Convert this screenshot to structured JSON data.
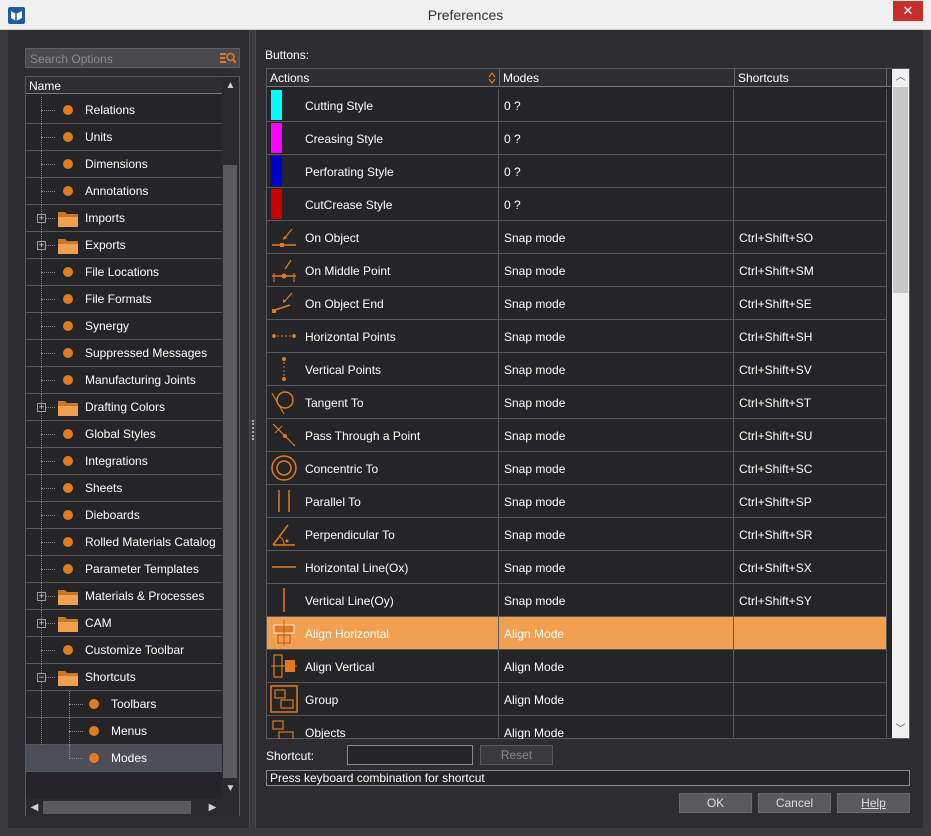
{
  "window": {
    "title": "Preferences",
    "close_glyph": "✕"
  },
  "search": {
    "placeholder": "Search Options"
  },
  "tree": {
    "header": "Name",
    "items": [
      {
        "label": "Relations",
        "kind": "leaf",
        "level": 1
      },
      {
        "label": "Units",
        "kind": "leaf",
        "level": 1
      },
      {
        "label": "Dimensions",
        "kind": "leaf",
        "level": 1
      },
      {
        "label": "Annotations",
        "kind": "leaf",
        "level": 1
      },
      {
        "label": "Imports",
        "kind": "folder",
        "level": 1,
        "expander": "+"
      },
      {
        "label": "Exports",
        "kind": "folder",
        "level": 1,
        "expander": "+"
      },
      {
        "label": "File Locations",
        "kind": "leaf",
        "level": 1
      },
      {
        "label": "File Formats",
        "kind": "leaf",
        "level": 1
      },
      {
        "label": "Synergy",
        "kind": "leaf",
        "level": 1
      },
      {
        "label": "Suppressed Messages",
        "kind": "leaf",
        "level": 1
      },
      {
        "label": "Manufacturing Joints",
        "kind": "leaf",
        "level": 1
      },
      {
        "label": "Drafting Colors",
        "kind": "folder",
        "level": 1,
        "expander": "+"
      },
      {
        "label": "Global Styles",
        "kind": "leaf",
        "level": 1
      },
      {
        "label": "Integrations",
        "kind": "leaf",
        "level": 1
      },
      {
        "label": "Sheets",
        "kind": "leaf",
        "level": 1
      },
      {
        "label": "Dieboards",
        "kind": "leaf",
        "level": 1
      },
      {
        "label": "Rolled Materials Catalog",
        "kind": "leaf",
        "level": 1
      },
      {
        "label": "Parameter Templates",
        "kind": "leaf",
        "level": 1
      },
      {
        "label": "Materials & Processes",
        "kind": "folder",
        "level": 1,
        "expander": "+"
      },
      {
        "label": "CAM",
        "kind": "folder",
        "level": 1,
        "expander": "+"
      },
      {
        "label": "Customize Toolbar",
        "kind": "leaf",
        "level": 1
      },
      {
        "label": "Shortcuts",
        "kind": "folder",
        "level": 1,
        "expander": "−"
      },
      {
        "label": "Toolbars",
        "kind": "leaf",
        "level": 2
      },
      {
        "label": "Menus",
        "kind": "leaf",
        "level": 2
      },
      {
        "label": "Modes",
        "kind": "leaf",
        "level": 2,
        "selected": true
      }
    ]
  },
  "buttons_label": "Buttons:",
  "grid": {
    "columns": [
      "Actions",
      "Modes",
      "Shortcuts"
    ],
    "rows": [
      {
        "action": "Cutting Style",
        "mode": "0 ?",
        "shortcut": "",
        "swatch": "#00ffff"
      },
      {
        "action": "Creasing Style",
        "mode": "0 ?",
        "shortcut": "",
        "swatch": "#ff00ff"
      },
      {
        "action": "Perforating Style",
        "mode": "0 ?",
        "shortcut": "",
        "swatch": "#0000cc"
      },
      {
        "action": "CutCrease Style",
        "mode": "0 ?",
        "shortcut": "",
        "swatch": "#cc0000"
      },
      {
        "action": "On Object",
        "mode": "Snap mode",
        "shortcut": "Ctrl+Shift+SO",
        "icon": "on-object-icon"
      },
      {
        "action": "On Middle Point",
        "mode": "Snap mode",
        "shortcut": "Ctrl+Shift+SM",
        "icon": "middle-point-icon"
      },
      {
        "action": "On Object End",
        "mode": "Snap mode",
        "shortcut": "Ctrl+Shift+SE",
        "icon": "object-end-icon"
      },
      {
        "action": "Horizontal Points",
        "mode": "Snap mode",
        "shortcut": "Ctrl+Shift+SH",
        "icon": "horizontal-points-icon"
      },
      {
        "action": "Vertical Points",
        "mode": "Snap mode",
        "shortcut": "Ctrl+Shift+SV",
        "icon": "vertical-points-icon"
      },
      {
        "action": "Tangent To",
        "mode": "Snap mode",
        "shortcut": "Ctrl+Shift+ST",
        "icon": "tangent-icon"
      },
      {
        "action": "Pass Through a Point",
        "mode": "Snap mode",
        "shortcut": "Ctrl+Shift+SU",
        "icon": "pass-through-icon"
      },
      {
        "action": "Concentric To",
        "mode": "Snap mode",
        "shortcut": "Ctrl+Shift+SC",
        "icon": "concentric-icon"
      },
      {
        "action": "Parallel To",
        "mode": "Snap mode",
        "shortcut": "Ctrl+Shift+SP",
        "icon": "parallel-icon"
      },
      {
        "action": "Perpendicular To",
        "mode": "Snap mode",
        "shortcut": "Ctrl+Shift+SR",
        "icon": "perpendicular-icon"
      },
      {
        "action": "Horizontal Line(Ox)",
        "mode": "Snap mode",
        "shortcut": "Ctrl+Shift+SX",
        "icon": "horizontal-line-icon"
      },
      {
        "action": "Vertical Line(Oy)",
        "mode": "Snap mode",
        "shortcut": "Ctrl+Shift+SY",
        "icon": "vertical-line-icon"
      },
      {
        "action": "Align Horizontal",
        "mode": "Align Mode",
        "shortcut": "",
        "icon": "align-horizontal-icon",
        "selected": true
      },
      {
        "action": "Align Vertical",
        "mode": "Align Mode",
        "shortcut": "",
        "icon": "align-vertical-icon"
      },
      {
        "action": "Group",
        "mode": "Align Mode",
        "shortcut": "",
        "icon": "group-icon"
      },
      {
        "action": "Objects",
        "mode": "Align Mode",
        "shortcut": "",
        "icon": "objects-icon"
      }
    ]
  },
  "shortcut": {
    "label": "Shortcut:",
    "value": "",
    "reset_label": "Reset"
  },
  "status_text": "Press keyboard combination for shortcut",
  "footer": {
    "ok_label": "OK",
    "cancel_label": "Cancel",
    "help_label": "Help"
  },
  "colors": {
    "accent": "#e07b1f",
    "selection": "#f0a050",
    "background": "#2d2d30"
  }
}
